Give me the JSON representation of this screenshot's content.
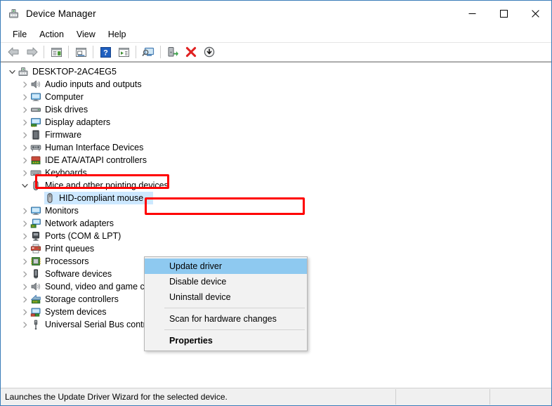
{
  "window": {
    "title": "Device Manager",
    "icon": "device-manager-icon",
    "buttons": {
      "minimize": "minimize",
      "maximize": "maximize",
      "close": "close"
    }
  },
  "menubar": {
    "items": [
      {
        "label": "File"
      },
      {
        "label": "Action"
      },
      {
        "label": "View"
      },
      {
        "label": "Help"
      }
    ]
  },
  "toolbar": {
    "buttons": [
      {
        "name": "back-icon"
      },
      {
        "name": "forward-icon"
      },
      {
        "name": "separator"
      },
      {
        "name": "show-hide-console-tree-icon"
      },
      {
        "name": "separator"
      },
      {
        "name": "properties-icon"
      },
      {
        "name": "separator"
      },
      {
        "name": "help-icon"
      },
      {
        "name": "update-driver-icon"
      },
      {
        "name": "separator"
      },
      {
        "name": "scan-for-hardware-changes-icon"
      },
      {
        "name": "separator"
      },
      {
        "name": "enable-device-icon"
      },
      {
        "name": "uninstall-device-icon"
      },
      {
        "name": "disable-device-icon"
      }
    ]
  },
  "tree": {
    "root": {
      "label": "DESKTOP-2AC4EG5",
      "icon": "computer-node-icon",
      "expanded": true
    },
    "items": [
      {
        "label": "Audio inputs and outputs",
        "icon": "speaker-icon",
        "level": 1,
        "expandable": true,
        "expanded": false
      },
      {
        "label": "Computer",
        "icon": "monitor-icon",
        "level": 1,
        "expandable": true,
        "expanded": false
      },
      {
        "label": "Disk drives",
        "icon": "disk-drive-icon",
        "level": 1,
        "expandable": true,
        "expanded": false
      },
      {
        "label": "Display adapters",
        "icon": "display-adapter-icon",
        "level": 1,
        "expandable": true,
        "expanded": false
      },
      {
        "label": "Firmware",
        "icon": "firmware-chip-icon",
        "level": 1,
        "expandable": true,
        "expanded": false
      },
      {
        "label": "Human Interface Devices",
        "icon": "hid-icon",
        "level": 1,
        "expandable": true,
        "expanded": false
      },
      {
        "label": "IDE ATA/ATAPI controllers",
        "icon": "ide-controller-icon",
        "level": 1,
        "expandable": true,
        "expanded": false
      },
      {
        "label": "Keyboards",
        "icon": "keyboard-icon",
        "level": 1,
        "expandable": true,
        "expanded": false
      },
      {
        "label": "Mice and other pointing devices",
        "icon": "mouse-icon",
        "level": 1,
        "expandable": true,
        "expanded": true,
        "highlighted": true
      },
      {
        "label": "HID-compliant mouse",
        "icon": "mouse-icon",
        "level": 2,
        "expandable": false,
        "selected": true
      },
      {
        "label": "Monitors",
        "icon": "monitor-icon",
        "level": 1,
        "expandable": true,
        "expanded": false
      },
      {
        "label": "Network adapters",
        "icon": "network-adapter-icon",
        "level": 1,
        "expandable": true,
        "expanded": false
      },
      {
        "label": "Ports (COM & LPT)",
        "icon": "port-icon",
        "level": 1,
        "expandable": true,
        "expanded": false
      },
      {
        "label": "Print queues",
        "icon": "printer-icon",
        "level": 1,
        "expandable": true,
        "expanded": false
      },
      {
        "label": "Processors",
        "icon": "processor-icon",
        "level": 1,
        "expandable": true,
        "expanded": false
      },
      {
        "label": "Software devices",
        "icon": "software-device-icon",
        "level": 1,
        "expandable": true,
        "expanded": false
      },
      {
        "label": "Sound, video and game controllers",
        "icon": "speaker-icon",
        "level": 1,
        "expandable": true,
        "expanded": false
      },
      {
        "label": "Storage controllers",
        "icon": "storage-controller-icon",
        "level": 1,
        "expandable": true,
        "expanded": false
      },
      {
        "label": "System devices",
        "icon": "system-device-icon",
        "level": 1,
        "expandable": true,
        "expanded": false
      },
      {
        "label": "Universal Serial Bus controllers",
        "icon": "usb-icon",
        "level": 1,
        "expandable": true,
        "expanded": false
      }
    ]
  },
  "context_menu": {
    "items": [
      {
        "label": "Update driver",
        "highlighted": true,
        "bold": false
      },
      {
        "label": "Disable device",
        "highlighted": false,
        "bold": false
      },
      {
        "label": "Uninstall device",
        "highlighted": false,
        "bold": false
      },
      {
        "separator": true
      },
      {
        "label": "Scan for hardware changes",
        "highlighted": false,
        "bold": false
      },
      {
        "separator": true
      },
      {
        "label": "Properties",
        "highlighted": false,
        "bold": true
      }
    ]
  },
  "statusbar": {
    "message": "Launches the Update Driver Wizard for the selected device.",
    "pane2": "",
    "pane3": ""
  },
  "colors": {
    "annotation": "#ff0000",
    "selection": "#cde8ff",
    "menu_highlight": "#8ec9f0",
    "window_border": "#3a7cb8"
  }
}
